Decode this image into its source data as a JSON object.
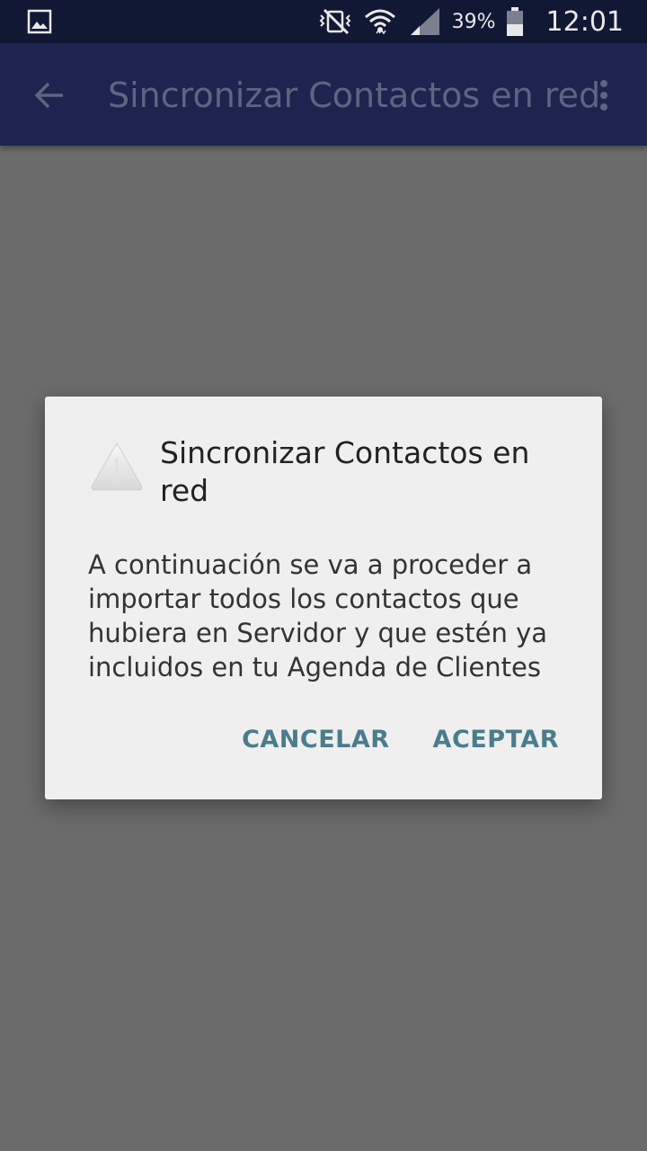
{
  "status_bar": {
    "battery_percent": "39%",
    "time": "12:01",
    "icons": [
      "gallery-icon",
      "vibrate-mute-icon",
      "wifi-icon",
      "signal-icon",
      "battery-icon"
    ]
  },
  "app_bar": {
    "title": "Sincronizar Contactos en red",
    "icons": [
      "back-arrow-icon",
      "overflow-menu-icon"
    ]
  },
  "dialog": {
    "title": "Sincronizar Contactos en red",
    "icon": "warning-icon",
    "message": "A continuación se va a proceder a importar todos los contactos que hubiera en Servidor y que estén ya incluidos en tu Agenda de Clientes",
    "cancel_label": "CANCELAR",
    "accept_label": "ACEPTAR"
  },
  "colors": {
    "status_bar_bg": "#111833",
    "app_bar_bg": "#1c244f",
    "scrim_bg": "#6b6b6b",
    "dialog_bg": "#efefef",
    "button_text": "#4a7d8c"
  }
}
